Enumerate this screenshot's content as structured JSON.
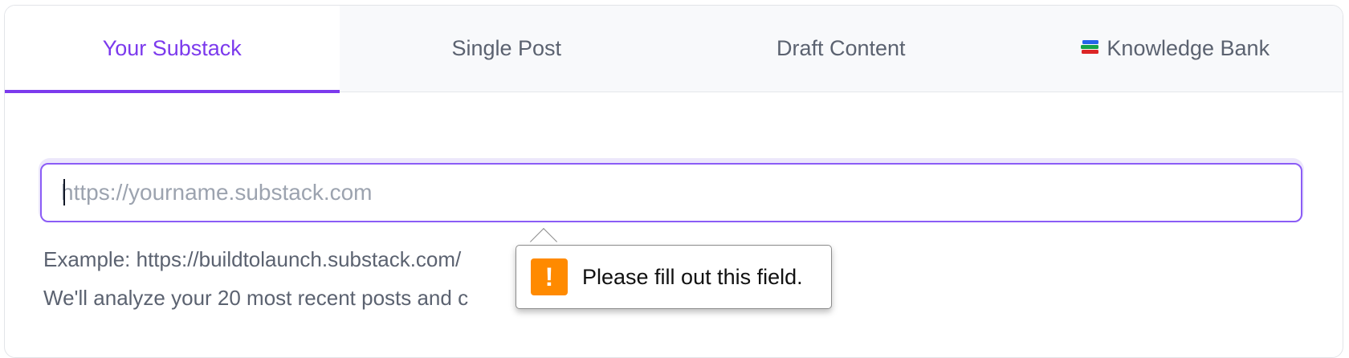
{
  "tabs": [
    {
      "label": "Your Substack",
      "active": true
    },
    {
      "label": "Single Post",
      "active": false
    },
    {
      "label": "Draft Content",
      "active": false
    },
    {
      "label": "Knowledge Bank",
      "active": false,
      "icon": "books-icon"
    }
  ],
  "url_field": {
    "value": "",
    "placeholder": "https://yourname.substack.com"
  },
  "hints": {
    "example": "Example: https://buildtolaunch.substack.com/",
    "analyze": "We'll analyze your 20 most recent posts and c"
  },
  "validation_tooltip": {
    "icon": "warning-icon",
    "glyph": "!",
    "message": "Please fill out this field."
  },
  "colors": {
    "accent": "#7c3aed",
    "warning": "#ff8a00"
  }
}
